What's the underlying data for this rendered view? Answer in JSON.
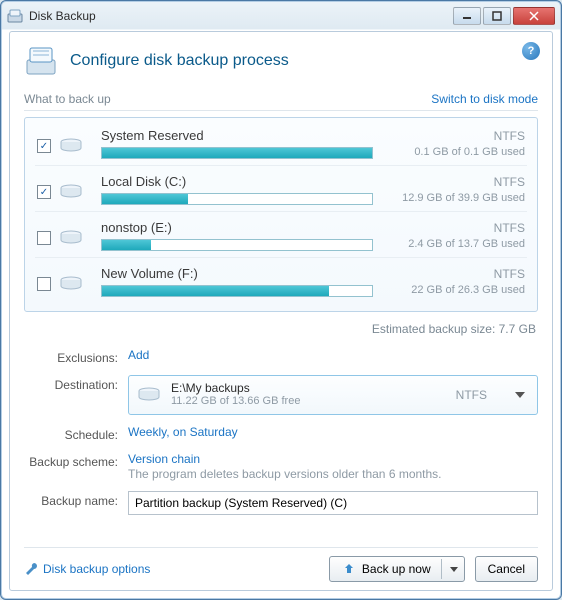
{
  "window": {
    "title": "Disk Backup"
  },
  "header": {
    "title": "Configure disk backup process"
  },
  "section": {
    "what": "What to back up",
    "switch": "Switch to disk mode"
  },
  "volumes": [
    {
      "name": "System Reserved",
      "fs": "NTFS",
      "usage": "0.1 GB of 0.1 GB used",
      "fill_pct": 100,
      "checked": true
    },
    {
      "name": "Local Disk (C:)",
      "fs": "NTFS",
      "usage": "12.9 GB of 39.9 GB used",
      "fill_pct": 32,
      "checked": true
    },
    {
      "name": "nonstop (E:)",
      "fs": "NTFS",
      "usage": "2.4 GB of 13.7 GB used",
      "fill_pct": 18,
      "checked": false
    },
    {
      "name": "New Volume (F:)",
      "fs": "NTFS",
      "usage": "22 GB of 26.3 GB used",
      "fill_pct": 84,
      "checked": false
    }
  ],
  "estimate": "Estimated backup size:  7.7 GB",
  "form": {
    "exclusions_label": "Exclusions:",
    "exclusions_link": "Add",
    "destination_label": "Destination:",
    "destination_path": "E:\\My backups",
    "destination_free": "11.22 GB of 13.66 GB free",
    "destination_fs": "NTFS",
    "schedule_label": "Schedule:",
    "schedule_value": "Weekly, on Saturday",
    "scheme_label": "Backup scheme:",
    "scheme_value": "Version chain",
    "scheme_desc": "The program deletes backup versions older than 6 months.",
    "name_label": "Backup name:",
    "name_value": "Partition backup (System Reserved) (C)"
  },
  "footer": {
    "options_link": "Disk backup options",
    "backup_btn": "Back up now",
    "cancel_btn": "Cancel"
  }
}
